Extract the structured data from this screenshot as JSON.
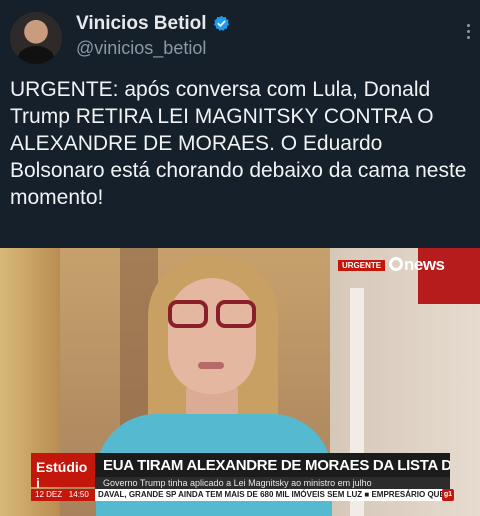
{
  "author": {
    "display_name": "Vinicios Betiol",
    "handle": "@vinicios_betiol",
    "verified_color": "#1d9bf0"
  },
  "post": {
    "text": "URGENTE: após conversa com Lula, Donald Trump RETIRA LEI MAGNITSKY CONTRA O ALEXANDRE DE MORAES. O Eduardo Bolsonaro está chorando debaixo da cama neste momento!"
  },
  "media": {
    "badge": "URGENTE",
    "logo": "news",
    "program": "Estúdio i",
    "headline": "EUA TIRAM ALEXANDRE DE MORAES DA LISTA DE SANÇÕES",
    "subheadline": "Governo Trump tinha aplicado a Lei Magnitsky ao ministro em julho",
    "date": "12 DEZ",
    "time": "14:50",
    "ticker": "DAVAL, GRANDE SP AINDA TEM MAIS DE 680 MIL IMÓVEIS SEM LUZ  ■  EMPRESÁRIO QUE I",
    "corner_logo": "g1"
  }
}
